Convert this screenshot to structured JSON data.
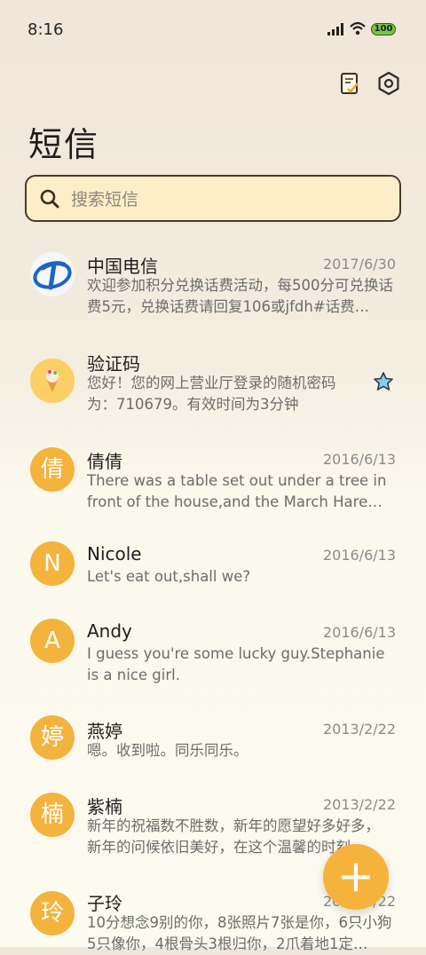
{
  "status": {
    "time": "8:16",
    "battery": "100"
  },
  "header": {
    "title": "短信"
  },
  "search": {
    "placeholder": "搜索短信"
  },
  "messages": [
    {
      "name": "中国电信",
      "date": "2017/6/30",
      "preview": "欢迎参加积分兑换话费活动，每500分可兑换话费5元，兑换话费请回复106或jfdh#话费…"
    },
    {
      "name": "验证码",
      "date": "",
      "preview": "您好！您的网上营业厅登录的随机密码为：710679。有效时间为3分钟"
    },
    {
      "name": "倩倩",
      "avatar": "倩",
      "date": "2016/6/13",
      "preview": "There was a table set out under a tree in front of the house,and the March Hare an…"
    },
    {
      "name": "Nicole",
      "avatar": "N",
      "date": "2016/6/13",
      "preview": "Let's eat out,shall we?"
    },
    {
      "name": "Andy",
      "avatar": "A",
      "date": "2016/6/13",
      "preview": "I guess you're some lucky guy.Stephanie is a nice girl."
    },
    {
      "name": "燕婷",
      "avatar": "婷",
      "date": "2013/2/22",
      "preview": "嗯。收到啦。同乐同乐。"
    },
    {
      "name": "紫楠",
      "avatar": "楠",
      "date": "2013/2/22",
      "preview": "新年的祝福数不胜数，新年的愿望好多好多，新年的问候依旧美好，在这个温馨的时刻…"
    },
    {
      "name": "子玲",
      "avatar": "玲",
      "date": "2013/2/22",
      "preview": "10分想念9别的你，8张照片7张是你，6只小狗5只像你，4根骨头3根归你，2爪着地1定…"
    }
  ],
  "fab": {
    "label": "+"
  },
  "colors": {
    "accent": "#f3b33d",
    "background": "#fbf8ec"
  }
}
